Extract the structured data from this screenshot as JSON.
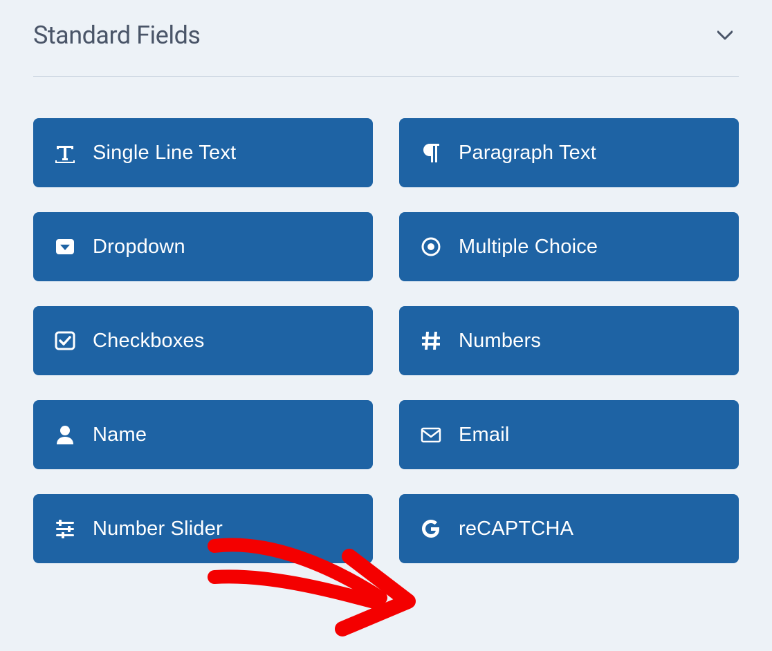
{
  "section": {
    "title": "Standard Fields"
  },
  "fields": [
    {
      "id": "single-line-text",
      "label": "Single Line Text",
      "icon": "text-icon"
    },
    {
      "id": "paragraph-text",
      "label": "Paragraph Text",
      "icon": "paragraph-icon"
    },
    {
      "id": "dropdown",
      "label": "Dropdown",
      "icon": "dropdown-icon"
    },
    {
      "id": "multiple-choice",
      "label": "Multiple Choice",
      "icon": "radio-icon"
    },
    {
      "id": "checkboxes",
      "label": "Checkboxes",
      "icon": "checkbox-icon"
    },
    {
      "id": "numbers",
      "label": "Numbers",
      "icon": "hash-icon"
    },
    {
      "id": "name",
      "label": "Name",
      "icon": "person-icon"
    },
    {
      "id": "email",
      "label": "Email",
      "icon": "envelope-icon"
    },
    {
      "id": "number-slider",
      "label": "Number Slider",
      "icon": "sliders-icon"
    },
    {
      "id": "recaptcha",
      "label": "reCAPTCHA",
      "icon": "google-icon"
    }
  ],
  "annotation": {
    "target": "recaptcha",
    "color": "#f40000"
  },
  "colors": {
    "button_bg": "#1e63a4",
    "page_bg": "#edf2f7",
    "title": "#4a5568"
  }
}
